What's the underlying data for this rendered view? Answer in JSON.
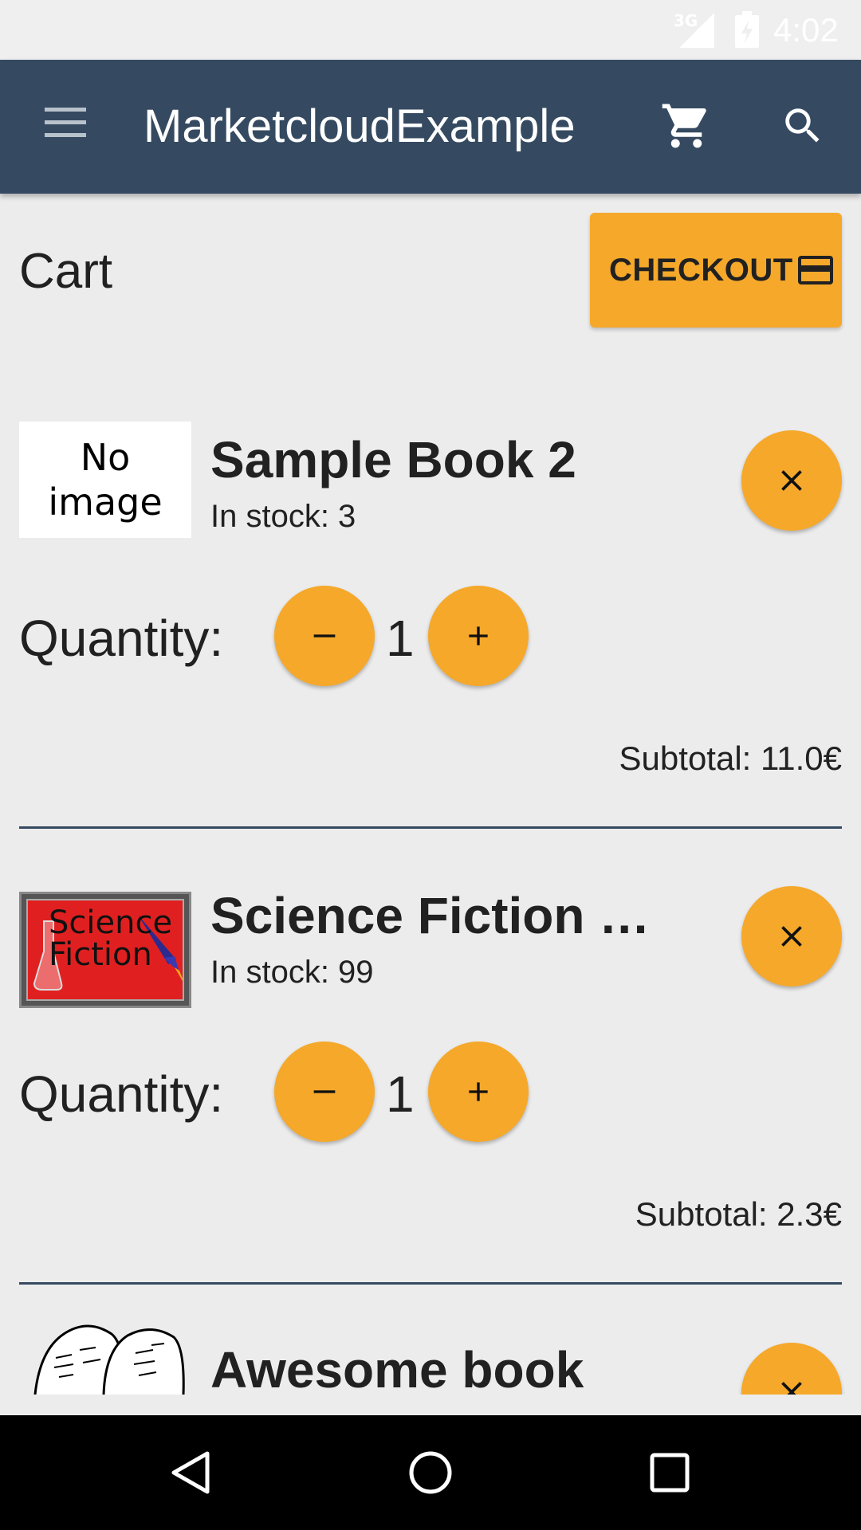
{
  "status_bar": {
    "network": "3G",
    "time": "4:02"
  },
  "app_bar": {
    "title": "MarketcloudExample"
  },
  "cart": {
    "title": "Cart",
    "checkout_label": "CHECKOUT"
  },
  "items": [
    {
      "image_text": "No\nimage",
      "name": "Sample Book 2",
      "stock": "In stock: 3",
      "quantity_label": "Quantity:",
      "quantity": "1",
      "minus": "−",
      "plus": "+",
      "subtotal": "Subtotal: 11.0€"
    },
    {
      "image_text": "Science\nFiction",
      "name": "Science Fiction M...",
      "stock": "In stock: 99",
      "quantity_label": "Quantity:",
      "quantity": "1",
      "minus": "−",
      "plus": "+",
      "subtotal": "Subtotal: 2.3€"
    },
    {
      "name": "Awesome book"
    }
  ],
  "colors": {
    "primary": "#354a61",
    "accent": "#f5a82a",
    "background": "#ececec"
  },
  "icons": [
    "menu-icon",
    "cart-icon",
    "search-icon",
    "credit-card-icon",
    "close-icon",
    "minus-icon",
    "plus-icon",
    "back-icon",
    "home-icon",
    "recents-icon"
  ]
}
